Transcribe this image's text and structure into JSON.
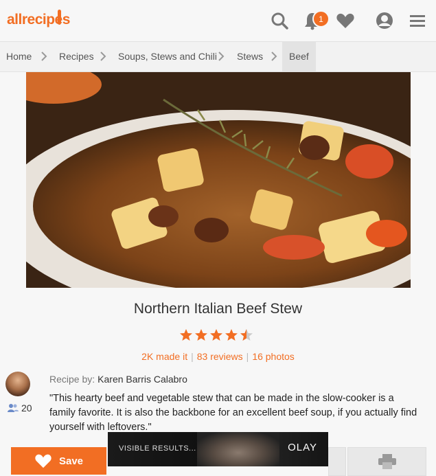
{
  "header": {
    "logo_text": "allrecipes",
    "notification_count": "1",
    "icons": [
      "search-icon",
      "bell-icon",
      "heart-icon",
      "profile-icon",
      "menu-icon"
    ],
    "accent_color": "#f26e23"
  },
  "breadcrumb": {
    "items": [
      "Home",
      "Recipes",
      "Soups, Stews and Chili",
      "Stews",
      "Beef"
    ]
  },
  "recipe": {
    "title": "Northern Italian Beef Stew",
    "rating": 4.5,
    "rating_max": 5,
    "made_it": "2K made it",
    "reviews": "83 reviews",
    "photos": "16 photos",
    "recipe_by_label": "Recipe by:",
    "author": "Karen Barris Calabro",
    "followers": "20",
    "description": "\"This hearty beef and vegetable stew that can be made in the slow-cooker is a family favorite. It is also the backbone for an excellent beef soup, if you actually find yourself with leftovers.\""
  },
  "actions": {
    "save_label": "Save"
  },
  "ad": {
    "text": "VISIBLE RESULTS...",
    "brand": "OLAY"
  }
}
